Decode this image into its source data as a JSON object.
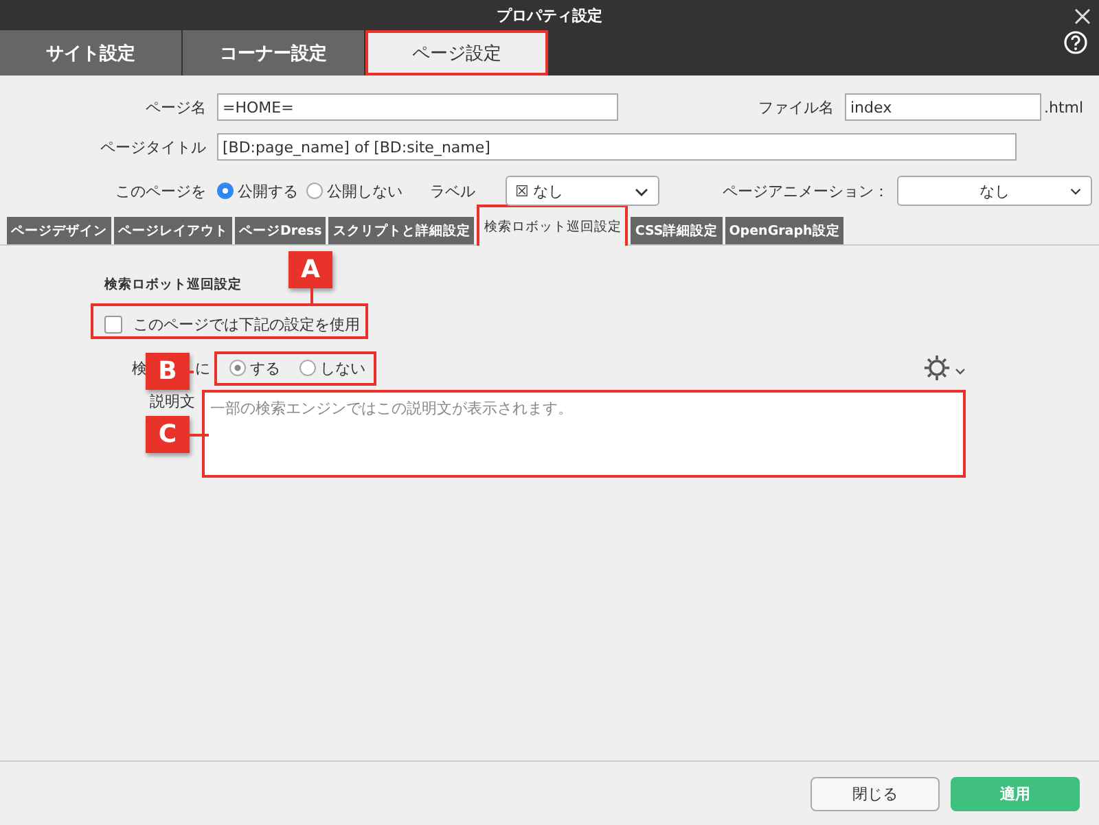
{
  "window": {
    "title": "プロパティ設定"
  },
  "top_tabs": [
    {
      "label": "サイト設定",
      "selected": false
    },
    {
      "label": "コーナー設定",
      "selected": false
    },
    {
      "label": "ページ設定",
      "selected": true
    }
  ],
  "form": {
    "page_name": {
      "label": "ページ名",
      "value": "=HOME="
    },
    "file_name": {
      "label": "ファイル名",
      "value": "index",
      "suffix": ".html"
    },
    "page_title": {
      "label": "ページタイトル",
      "value": "[BD:page_name] of [BD:site_name]"
    },
    "publish": {
      "label": "このページを",
      "options": [
        {
          "label": "公開する",
          "selected": true
        },
        {
          "label": "公開しない",
          "selected": false
        }
      ]
    },
    "tag": {
      "label": "ラベル",
      "icon": "☒",
      "value": "なし"
    },
    "animation": {
      "label": "ページアニメーション：",
      "value": "なし"
    }
  },
  "sub_tabs": [
    {
      "label": "ページデザイン",
      "selected": false
    },
    {
      "label": "ページレイアウト",
      "selected": false
    },
    {
      "label": "ページDress",
      "selected": false
    },
    {
      "label": "スクリプトと詳細設定",
      "selected": false
    },
    {
      "label": "検索ロボット巡回設定",
      "selected": true
    },
    {
      "label": "CSS詳細設定",
      "selected": false
    },
    {
      "label": "OpenGraph設定",
      "selected": false
    }
  ],
  "robots": {
    "heading": "検索ロボット巡回設定",
    "use_settings": {
      "label": "このページでは下記の設定を使用",
      "checked": false
    },
    "index_label_start": "検",
    "index_label_end": "に",
    "index_options": [
      {
        "label": "する",
        "selected": true
      },
      {
        "label": "しない",
        "selected": false
      }
    ],
    "description": {
      "label": "説明文",
      "placeholder": "一部の検索エンジンではこの説明文が表示されます。"
    }
  },
  "annotations": [
    {
      "label": "A"
    },
    {
      "label": "B"
    },
    {
      "label": "C"
    }
  ],
  "buttons": [
    {
      "label": "閉じる",
      "kind": "secondary"
    },
    {
      "label": "適用",
      "kind": "primary"
    }
  ]
}
